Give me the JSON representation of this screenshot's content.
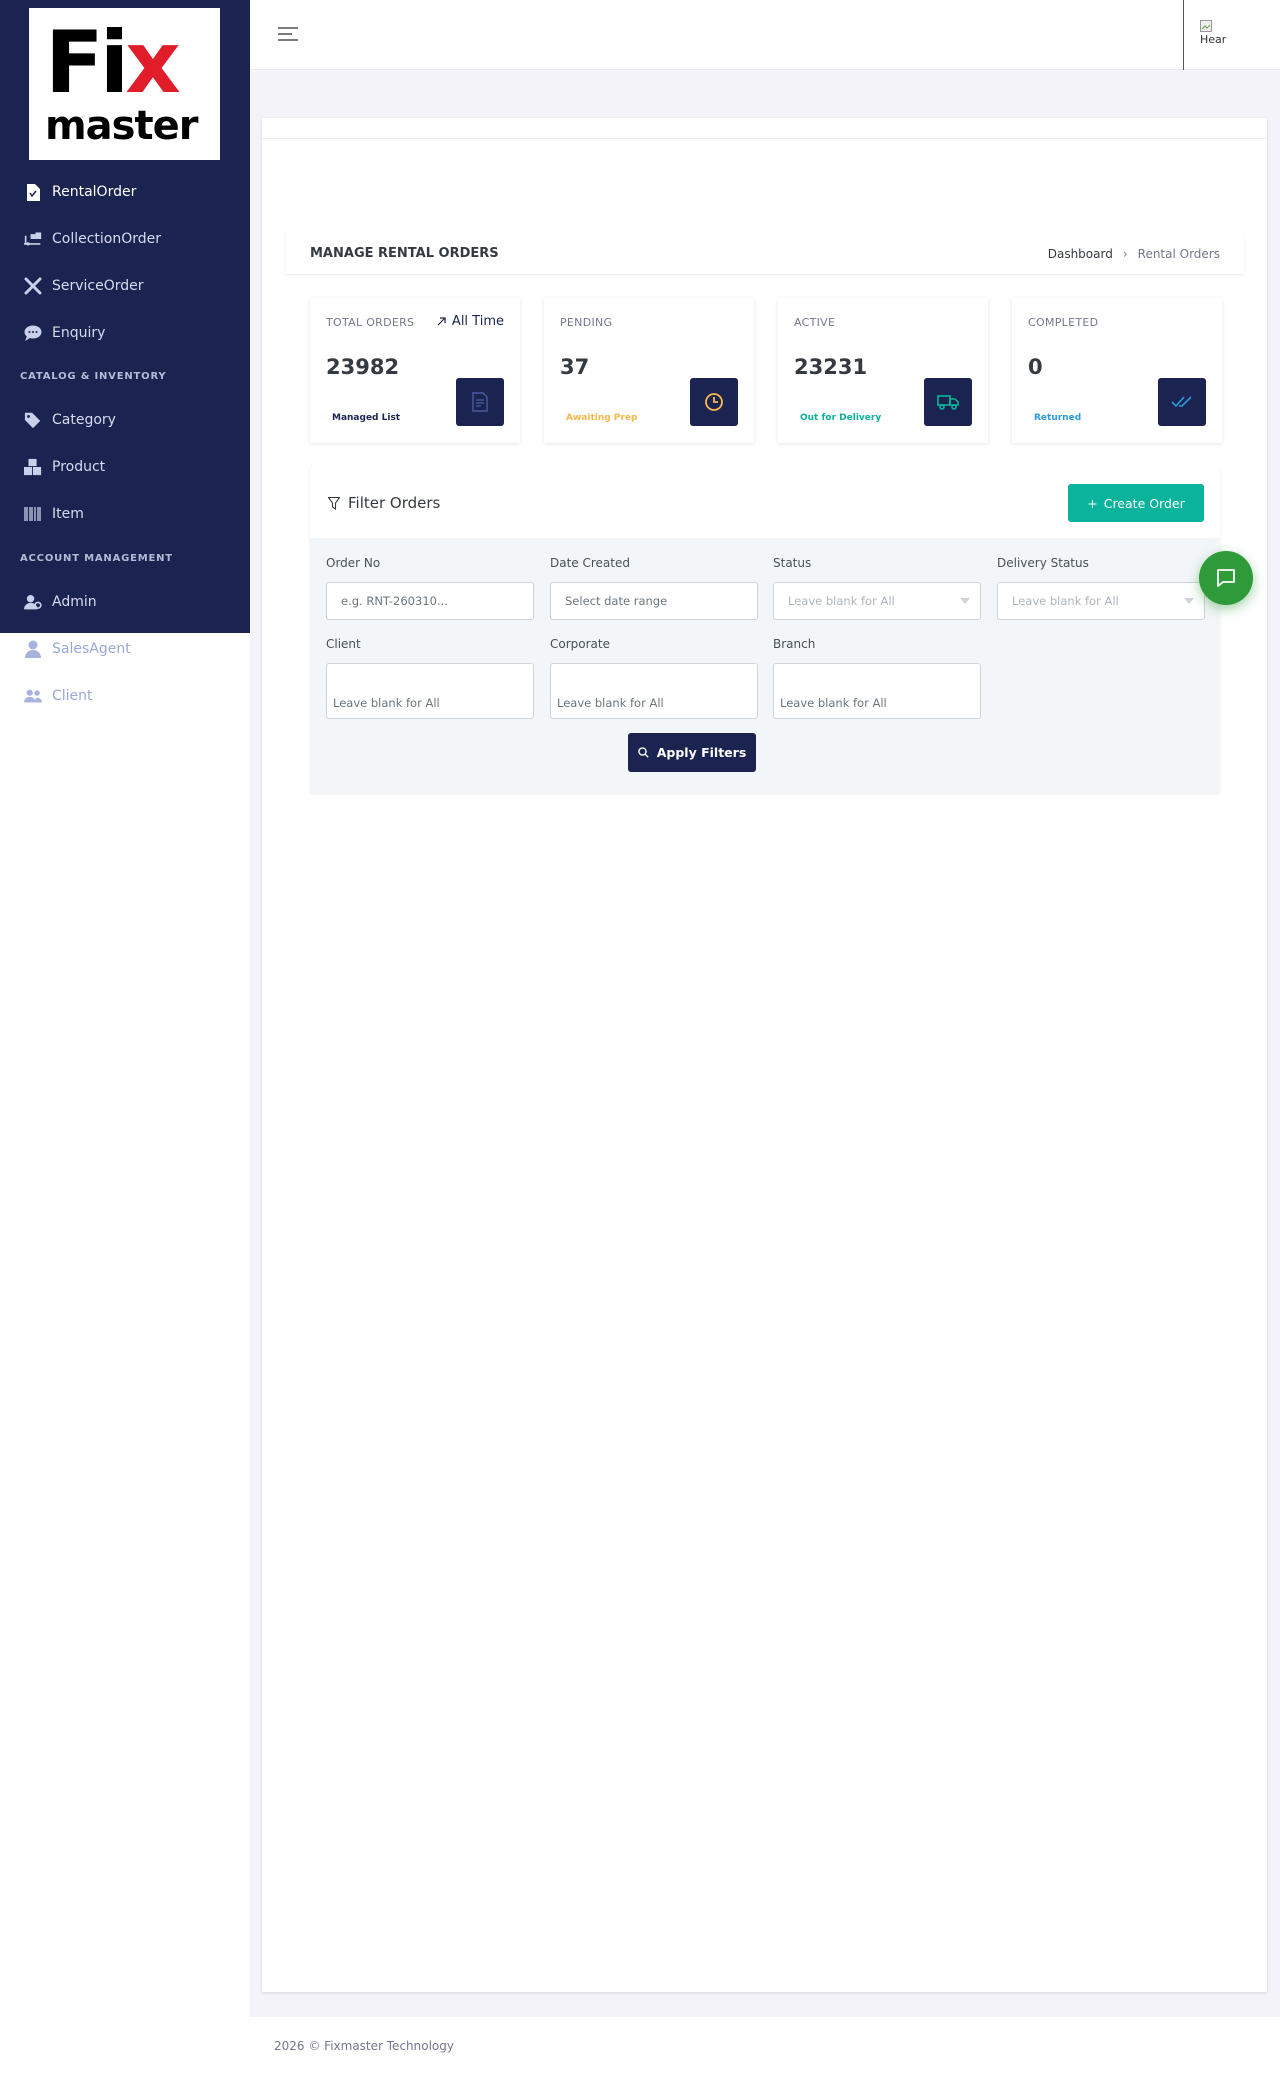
{
  "brand": {
    "logo_top": "Fix",
    "logo_bottom": "master",
    "accent": "#e11d2a",
    "sidebar_bg": "#1b2450"
  },
  "sidebar": {
    "items": [
      {
        "label": "RentalOrder",
        "icon": "file-icon"
      },
      {
        "label": "CollectionOrder",
        "icon": "truck-loading-icon"
      },
      {
        "label": "ServiceOrder",
        "icon": "tools-icon"
      },
      {
        "label": "Enquiry",
        "icon": "comment-icon"
      }
    ],
    "section_catalog": "CATALOG & INVENTORY",
    "catalog_items": [
      {
        "label": "Category",
        "icon": "tags-icon"
      },
      {
        "label": "Product",
        "icon": "boxes-icon"
      },
      {
        "label": "Item",
        "icon": "barcode-icon"
      }
    ],
    "section_account": "ACCOUNT MANAGEMENT",
    "account_items": [
      {
        "label": "Admin",
        "icon": "user-cog-icon"
      },
      {
        "label": "SalesAgent",
        "icon": "user-tie-icon"
      },
      {
        "label": "Client",
        "icon": "users-icon"
      }
    ]
  },
  "header": {
    "avatar_alt": "Hear"
  },
  "page": {
    "title": "MANAGE RENTAL ORDERS",
    "breadcrumb_home": "Dashboard",
    "breadcrumb_sep": "›",
    "breadcrumb_current": "Rental Orders"
  },
  "stats": [
    {
      "label": "TOTAL ORDERS",
      "value": "23982",
      "sub": "Managed List",
      "sub_color": "#1b2450",
      "icon": "document-icon",
      "extra": "All Time"
    },
    {
      "label": "PENDING",
      "value": "37",
      "sub": "Awaiting Prep",
      "sub_color": "#f7b84b",
      "icon": "clock-icon"
    },
    {
      "label": "ACTIVE",
      "value": "23231",
      "sub": "Out for Delivery",
      "sub_color": "#0ab39c",
      "icon": "truck-icon"
    },
    {
      "label": "COMPLETED",
      "value": "0",
      "sub": "Returned",
      "sub_color": "#299cdb",
      "icon": "double-check-icon"
    }
  ],
  "filter": {
    "title": "Filter Orders",
    "create_label": "Create Order",
    "order_no_label": "Order No",
    "order_no_placeholder": "e.g. RNT-260310...",
    "date_label": "Date Created",
    "date_placeholder": "Select date range",
    "status_label": "Status",
    "status_value": "Leave blank for All",
    "delivery_label": "Delivery Status",
    "delivery_value": "Leave blank for All",
    "client_label": "Client",
    "client_value": "Leave blank for All",
    "corporate_label": "Corporate",
    "corporate_value": "Leave blank for All",
    "branch_label": "Branch",
    "branch_value": "Leave blank for All",
    "apply_label": "Apply Filters"
  },
  "footer": {
    "text": "2026 © Fixmaster Technology"
  }
}
